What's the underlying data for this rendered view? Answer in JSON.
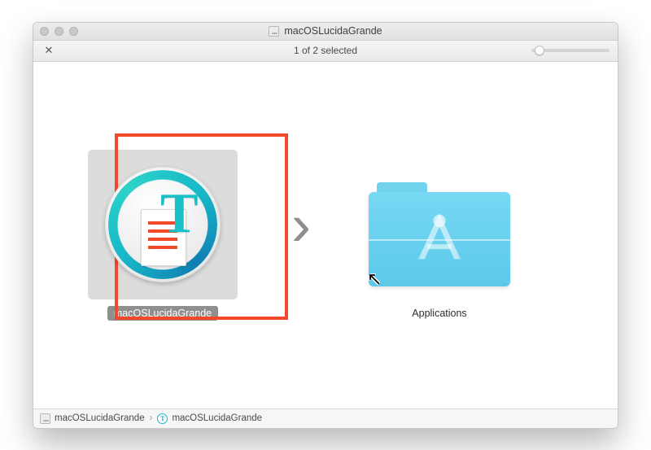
{
  "window": {
    "title": "macOSLucidaGrande"
  },
  "toolbar": {
    "status": "1 of 2 selected"
  },
  "items": {
    "app": {
      "label": "macOSLucidaGrande",
      "selected": true
    },
    "folder": {
      "label": "Applications",
      "selected": false
    }
  },
  "pathbar": {
    "segments": [
      {
        "label": "macOSLucidaGrande",
        "icon": "disk"
      },
      {
        "label": "macOSLucidaGrande",
        "icon": "app"
      }
    ]
  }
}
